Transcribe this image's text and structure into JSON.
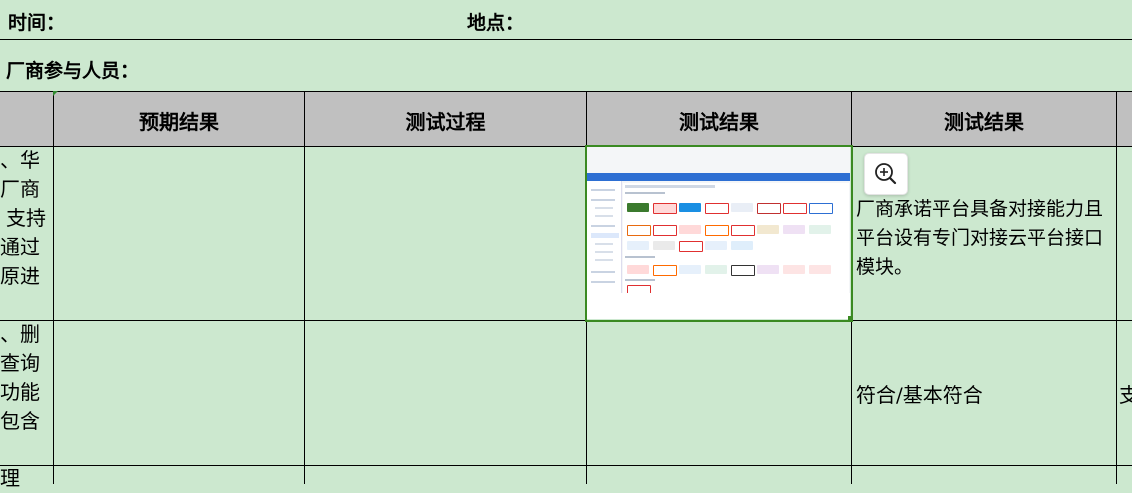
{
  "info": {
    "time_label": "时间：",
    "location_label": "地点：",
    "vendor_participants_label": "厂商参与人员："
  },
  "table": {
    "headers": [
      "预期结果",
      "测试过程",
      "测试结果",
      "测试结果"
    ],
    "row1": {
      "left_fragment": [
        "、华",
        "厂商",
        "支持",
        "通过",
        "原进"
      ],
      "description": "厂商承诺平台具备对接能力且平台设有专门对接云平台接口模块。"
    },
    "row2": {
      "left_fragment": [
        "、删",
        "查询",
        "功能",
        "包含"
      ],
      "result": "符合/基本符合",
      "right_fragment": "支"
    },
    "row3": {
      "left_fragment": [
        "理"
      ]
    }
  },
  "thumbnail": {
    "logos": [
      "VMware",
      "HUAWEI",
      "Windows",
      "H3C",
      "NUTANIX",
      "ZStack",
      "H3C",
      "EasyStack",
      "OpenStack",
      "H3C",
      "HUAWEI",
      "阿里云",
      "H3C",
      "浪潮云",
      "中国电信",
      "紫光云",
      "腾讯云",
      "新华三",
      "H3C",
      "深信服",
      "Amazon",
      "HUAWEI",
      "阿里云",
      "腾讯云",
      "易捷行云",
      "aws",
      "紫光云",
      "天翼云",
      "H3C"
    ],
    "colors": {
      "topbar": "#2d6fd3",
      "h3c": "#e03030",
      "huawei": "#d7262e",
      "aliyun": "#ff6a00",
      "tencent": "#1a8fe3"
    }
  },
  "zoom_icon": "zoom-in-icon"
}
